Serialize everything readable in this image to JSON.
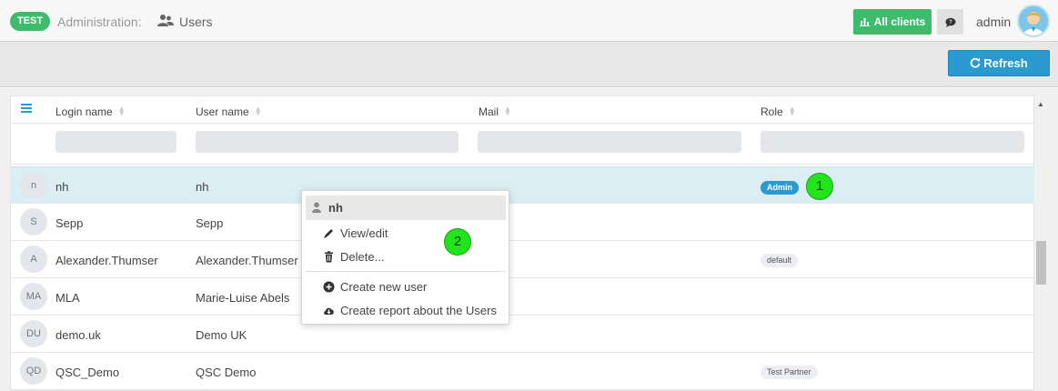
{
  "header": {
    "env_badge": "TEST",
    "breadcrumb": "Administration:",
    "current_page": "Users",
    "all_clients_label": "All clients",
    "user": "admin"
  },
  "toolbar": {
    "refresh_label": "Refresh"
  },
  "table": {
    "columns": [
      "Login name",
      "User name",
      "Mail",
      "Role"
    ],
    "rows": [
      {
        "initials": "n",
        "login": "nh",
        "username": "nh",
        "mail": "",
        "role": "Admin"
      },
      {
        "initials": "S",
        "login": "Sepp",
        "username": "Sepp",
        "mail": "",
        "role": ""
      },
      {
        "initials": "A",
        "login": "Alexander.Thumser",
        "username": "Alexander.Thumser",
        "mail": "",
        "role": "default"
      },
      {
        "initials": "MA",
        "login": "MLA",
        "username": "Marie-Luise Abels",
        "mail": "",
        "role": ""
      },
      {
        "initials": "DU",
        "login": "demo.uk",
        "username": "Demo UK",
        "mail": "",
        "role": ""
      },
      {
        "initials": "QD",
        "login": "QSC_Demo",
        "username": "QSC Demo",
        "mail": "",
        "role": "Test Partner"
      }
    ]
  },
  "context_menu": {
    "title": "nh",
    "items": [
      "View/edit",
      "Delete...",
      "Create new user",
      "Create report about the Users"
    ]
  },
  "callouts": [
    "1",
    "2"
  ],
  "colors": {
    "green": "#3ebc6c",
    "blue": "#2a9ad0",
    "selected_row": "#daeef3",
    "callout": "#22e41c"
  }
}
